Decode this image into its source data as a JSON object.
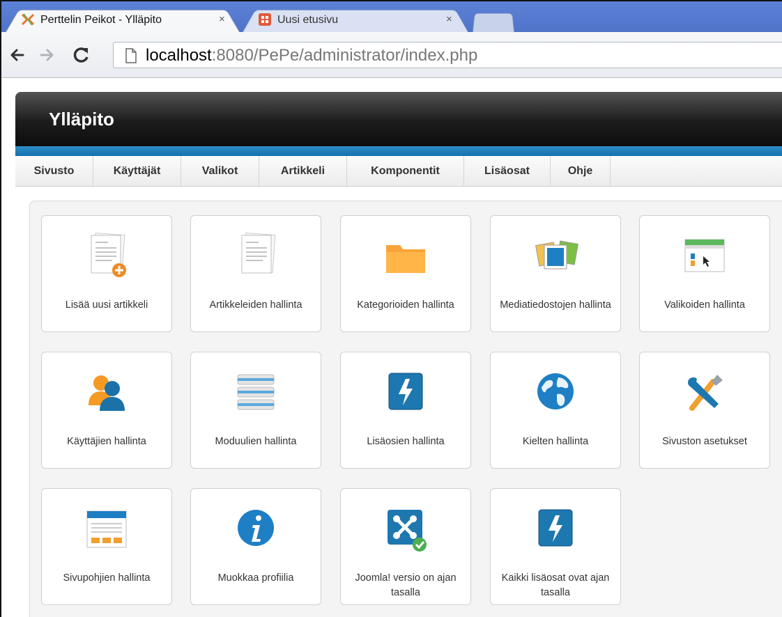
{
  "browser": {
    "tabs": [
      {
        "title": "Perttelin Peikot - Ylläpito",
        "close": "×",
        "active": true
      },
      {
        "title": "Uusi etusivu",
        "close": "×",
        "active": false
      }
    ],
    "url": {
      "host": "localhost",
      "rest": ":8080/PePe/administrator/index.php"
    }
  },
  "admin": {
    "title": "Ylläpito",
    "menu": [
      "Sivusto",
      "Käyttäjät",
      "Valikot",
      "Artikkeli",
      "Komponentit",
      "Lisäosat",
      "Ohje"
    ],
    "tiles": [
      {
        "label": "Lisää uusi artikkeli",
        "icon": "add-article-icon"
      },
      {
        "label": "Artikkeleiden hallinta",
        "icon": "article-manager-icon"
      },
      {
        "label": "Kategorioiden hallinta",
        "icon": "folder-icon"
      },
      {
        "label": "Mediatiedostojen hallinta",
        "icon": "media-icon"
      },
      {
        "label": "Valikoiden hallinta",
        "icon": "menu-manager-icon"
      },
      {
        "label": "Käyttäjien hallinta",
        "icon": "users-icon"
      },
      {
        "label": "Moduulien hallinta",
        "icon": "modules-icon"
      },
      {
        "label": "Lisäosien hallinta",
        "icon": "extensions-icon"
      },
      {
        "label": "Kielten hallinta",
        "icon": "globe-icon"
      },
      {
        "label": "Sivuston asetukset",
        "icon": "tools-icon"
      },
      {
        "label": "Sivupohjien hallinta",
        "icon": "template-icon"
      },
      {
        "label": "Muokkaa profiilia",
        "icon": "info-icon"
      },
      {
        "label": "Joomla! versio on ajan tasalla",
        "icon": "joomla-check-icon"
      },
      {
        "label": "Kaikki lisäosat ovat ajan tasalla",
        "icon": "extensions-update-icon"
      }
    ]
  },
  "colors": {
    "header": "#1c1c1c",
    "strip": "#1a78b6",
    "tabbar": "#5479cf"
  }
}
